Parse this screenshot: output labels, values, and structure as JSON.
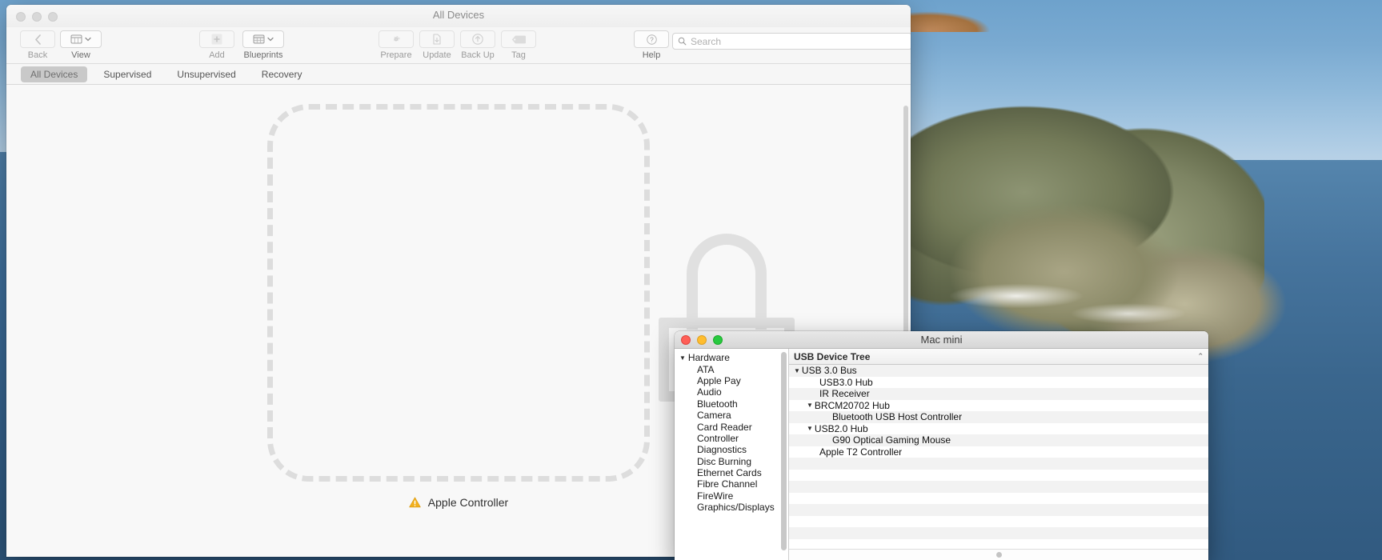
{
  "configurator": {
    "window_title": "All Devices",
    "traffic_lights": [
      "close",
      "minimize",
      "zoom"
    ],
    "toolbar": {
      "back_label": "Back",
      "view_label": "View",
      "add_label": "Add",
      "blueprints_label": "Blueprints",
      "prepare_label": "Prepare",
      "update_label": "Update",
      "backup_label": "Back Up",
      "tag_label": "Tag",
      "help_label": "Help",
      "search_placeholder": "Search",
      "search_value": "",
      "icons": {
        "back": "chevron-left-icon",
        "view": "grid-view-icon",
        "add": "plus-icon",
        "blueprints": "blueprints-grid-icon",
        "prepare": "gear-icon",
        "update": "download-icon",
        "backup": "upload-arrow-icon",
        "tag": "tag-icon",
        "help": "question-mark-icon",
        "search": "magnifier-icon"
      }
    },
    "tabs": [
      {
        "label": "All Devices",
        "active": true
      },
      {
        "label": "Supervised",
        "active": false
      },
      {
        "label": "Unsupervised",
        "active": false
      },
      {
        "label": "Recovery",
        "active": false
      }
    ],
    "placeholder": {
      "icon": "lock-icon",
      "caption_icon": "warning-triangle-icon",
      "caption_text": "Apple Controller",
      "caption_icon_color": "#f2b01e"
    }
  },
  "mac_mini": {
    "window_title": "Mac mini",
    "traffic_lights": {
      "close_color": "#ff5f57",
      "minimize_color": "#ffbd2e",
      "zoom_color": "#28c940"
    },
    "sidebar": {
      "items": [
        {
          "label": "Hardware",
          "level": 0,
          "expanded": true
        },
        {
          "label": "ATA",
          "level": 1
        },
        {
          "label": "Apple Pay",
          "level": 1
        },
        {
          "label": "Audio",
          "level": 1
        },
        {
          "label": "Bluetooth",
          "level": 1
        },
        {
          "label": "Camera",
          "level": 1
        },
        {
          "label": "Card Reader",
          "level": 1
        },
        {
          "label": "Controller",
          "level": 1
        },
        {
          "label": "Diagnostics",
          "level": 1
        },
        {
          "label": "Disc Burning",
          "level": 1
        },
        {
          "label": "Ethernet Cards",
          "level": 1
        },
        {
          "label": "Fibre Channel",
          "level": 1
        },
        {
          "label": "FireWire",
          "level": 1
        },
        {
          "label": "Graphics/Displays",
          "level": 1
        }
      ]
    },
    "detail": {
      "column_header": "USB Device Tree",
      "sort_indicator": "chevron-up-icon",
      "rows": [
        {
          "label": "USB 3.0 Bus",
          "level": 0,
          "expanded": true
        },
        {
          "label": "USB3.0 Hub",
          "level": 2,
          "expanded": false
        },
        {
          "label": "IR Receiver",
          "level": 2,
          "expanded": false
        },
        {
          "label": "BRCM20702 Hub",
          "level": 1,
          "expanded": true
        },
        {
          "label": "Bluetooth USB Host Controller",
          "level": 3,
          "expanded": false
        },
        {
          "label": "USB2.0 Hub",
          "level": 1,
          "expanded": true
        },
        {
          "label": "G90 Optical Gaming Mouse",
          "level": 3,
          "expanded": false
        },
        {
          "label": "Apple T2 Controller",
          "level": 2,
          "expanded": false
        }
      ]
    }
  }
}
